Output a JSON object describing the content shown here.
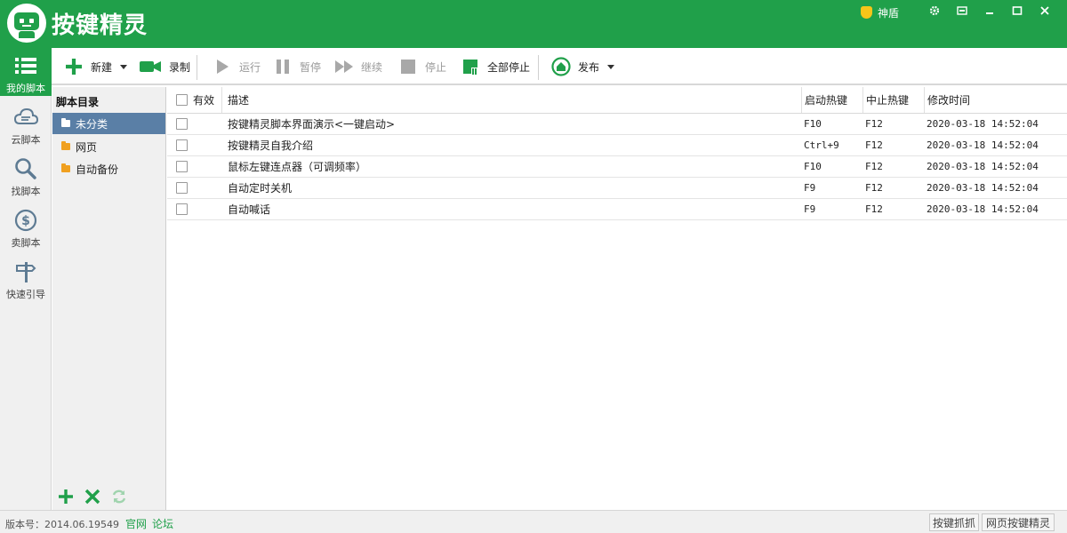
{
  "app": {
    "title": "按键精灵"
  },
  "titlebar": {
    "shield_label": "神盾"
  },
  "sidebar": {
    "items": [
      {
        "label": "我的脚本",
        "icon": "list-icon",
        "active": true
      },
      {
        "label": "云脚本",
        "icon": "cloud-icon",
        "active": false
      },
      {
        "label": "找脚本",
        "icon": "search-icon",
        "active": false
      },
      {
        "label": "卖脚本",
        "icon": "dollar-icon",
        "active": false
      },
      {
        "label": "快速引导",
        "icon": "signpost-icon",
        "active": false
      }
    ]
  },
  "toolbar": {
    "new_label": "新建",
    "record_label": "录制",
    "run_label": "运行",
    "pause_label": "暂停",
    "continue_label": "继续",
    "stop_label": "停止",
    "stop_all_label": "全部停止",
    "publish_label": "发布"
  },
  "directory": {
    "title": "脚本目录",
    "items": [
      {
        "label": "未分类",
        "selected": true
      },
      {
        "label": "网页",
        "selected": false
      },
      {
        "label": "自动备份",
        "selected": false
      }
    ]
  },
  "table": {
    "columns": [
      "有效",
      "描述",
      "启动热键",
      "中止热键",
      "修改时间"
    ],
    "rows": [
      {
        "desc": "按键精灵脚本界面演示<一键启动>",
        "start": "F10",
        "stop": "F12",
        "time": "2020-03-18 14:52:04"
      },
      {
        "desc": "按键精灵自我介绍",
        "start": "Ctrl+9",
        "stop": "F12",
        "time": "2020-03-18 14:52:04"
      },
      {
        "desc": "鼠标左键连点器（可调频率）",
        "start": "F10",
        "stop": "F12",
        "time": "2020-03-18 14:52:04"
      },
      {
        "desc": "自动定时关机",
        "start": "F9",
        "stop": "F12",
        "time": "2020-03-18 14:52:04"
      },
      {
        "desc": "自动喊话",
        "start": "F9",
        "stop": "F12",
        "time": "2020-03-18 14:52:04"
      }
    ]
  },
  "status": {
    "version": "版本号：2014.06.19549",
    "link_official": "官网",
    "link_forum": "论坛",
    "btn_capture": "按键抓抓",
    "btn_web": "网页按键精灵"
  },
  "colors": {
    "brand_green": "#20a04a",
    "selection_blue": "#5a7fa6"
  }
}
